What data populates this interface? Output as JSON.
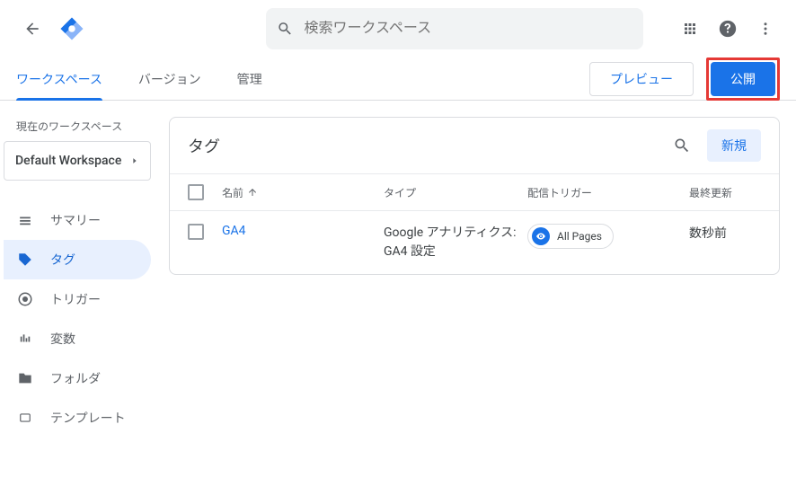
{
  "search": {
    "placeholder": "検索ワークスペース"
  },
  "tabs": {
    "workspace": "ワークスペース",
    "versions": "バージョン",
    "admin": "管理"
  },
  "actions": {
    "preview": "プレビュー",
    "publish": "公開"
  },
  "workspace": {
    "label": "現在のワークスペース",
    "name": "Default Workspace"
  },
  "nav": {
    "summary": "サマリー",
    "tags": "タグ",
    "triggers": "トリガー",
    "variables": "変数",
    "folders": "フォルダ",
    "templates": "テンプレート"
  },
  "card": {
    "title": "タグ",
    "new": "新規",
    "cols": {
      "name": "名前",
      "type": "タイプ",
      "trigger": "配信トリガー",
      "updated": "最終更新"
    }
  },
  "rows": [
    {
      "name": "GA4",
      "type": "Google アナリティクス: GA4 設定",
      "trigger": "All Pages",
      "updated": "数秒前"
    }
  ]
}
